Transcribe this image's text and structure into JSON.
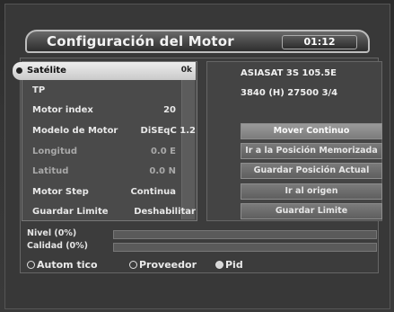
{
  "header": {
    "title": "Configuración del Motor",
    "clock": "01:12"
  },
  "menu": {
    "items": [
      {
        "label": "Satélite",
        "value": "0k",
        "selected": true
      },
      {
        "label": "TP",
        "value": ""
      },
      {
        "label": "Motor index",
        "value": "20"
      },
      {
        "label": "Modelo de Motor",
        "value": "DiSEqC 1.2"
      },
      {
        "label": "Longitud",
        "value": "0.0 E",
        "dim": true
      },
      {
        "label": "Latitud",
        "value": "0.0 N",
        "dim": true
      },
      {
        "label": "Motor Step",
        "value": "Continua"
      },
      {
        "label": "Guardar Limite",
        "value": "Deshabilitar"
      }
    ]
  },
  "info": {
    "satellite": "ASIASAT 3S  105.5E",
    "transponder": "3840 (H)  27500  3/4"
  },
  "actions": [
    {
      "label": "Mover Continuo",
      "highlight": true
    },
    {
      "label": "Ir a la Posición Memorizada",
      "highlight": false
    },
    {
      "label": "Guardar Posición Actual",
      "highlight": false
    },
    {
      "label": "Ir al origen",
      "highlight": false
    },
    {
      "label": "Guardar Limite",
      "highlight": false
    }
  ],
  "meters": {
    "level_label": "Nivel (0%)",
    "level_value": 0,
    "quality_label": "Calidad (0%)",
    "quality_value": 0
  },
  "legend": {
    "auto_label": "Autom tico",
    "provider_label": "Proveedor",
    "pid_label": "Pid"
  }
}
